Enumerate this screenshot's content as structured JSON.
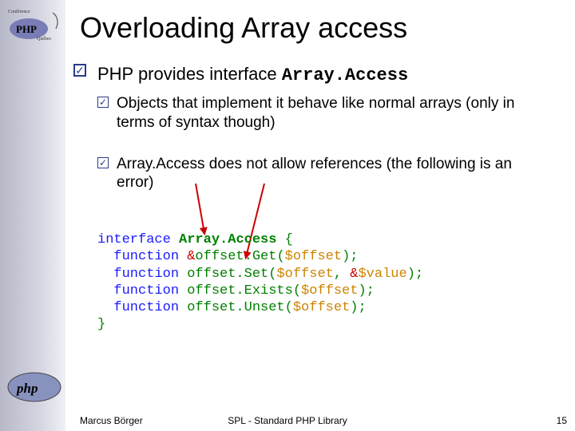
{
  "logos": {
    "conference_alt": "Conférence PHP Québec",
    "php_alt": "php"
  },
  "title": "Overloading Array access",
  "main": {
    "text_before": "PHP provides interface ",
    "interface": "Array.Access"
  },
  "subs": [
    "Objects that implement it behave like normal arrays (only in terms of syntax though)",
    "Array.Access does not allow references (the following is an error)"
  ],
  "code": {
    "l1_kw": "interface ",
    "l1_nm": "Array.Access ",
    "l1_brace": "{",
    "l2_kw": "  function ",
    "l2_amp": "&",
    "l2_nm": "offset.Get",
    "l2_open": "(",
    "l2_var": "$offset",
    "l2_close": ");",
    "l3_kw": "  function ",
    "l3_nm": "offset.Set",
    "l3_open": "(",
    "l3_var1": "$offset",
    "l3_comma": ", ",
    "l3_amp": "&",
    "l3_var2": "$value",
    "l3_close": ");",
    "l4_kw": "  function ",
    "l4_nm": "offset.Exists",
    "l4_open": "(",
    "l4_var": "$offset",
    "l4_close": ");",
    "l5_kw": "  function ",
    "l5_nm": "offset.Unset",
    "l5_open": "(",
    "l5_var": "$offset",
    "l5_close": ");",
    "l6_brace": "}"
  },
  "footer": {
    "author": "Marcus Börger",
    "center": "SPL - Standard PHP Library",
    "page": "15"
  },
  "colors": {
    "accent": "#2a3a8a",
    "error": "#cc0000"
  }
}
